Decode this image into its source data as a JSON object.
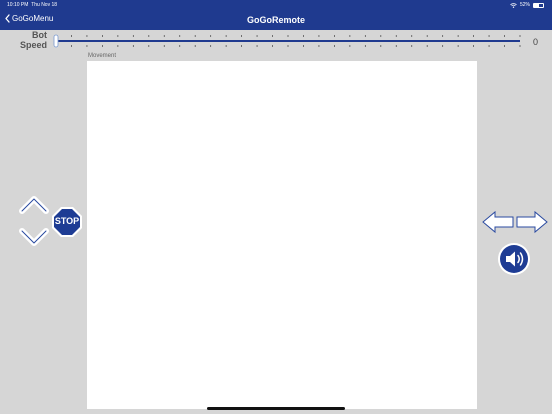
{
  "status_bar": {
    "time": "10:10 PM",
    "date": "Thu Nov 18",
    "battery": "52%",
    "battery_level": 0.52
  },
  "nav": {
    "back_label": "GoGoMenu",
    "title": "GoGoRemote"
  },
  "speed": {
    "label_line1": "Bot",
    "label_line2": "Speed",
    "value": "0",
    "level": 0
  },
  "movement": {
    "label": "Movement"
  },
  "controls": {
    "stop_label": "STOP"
  },
  "colors": {
    "nav_bg": "#1f3a8f",
    "stop_bg": "#1e3c94",
    "background": "#d6d6d6"
  }
}
